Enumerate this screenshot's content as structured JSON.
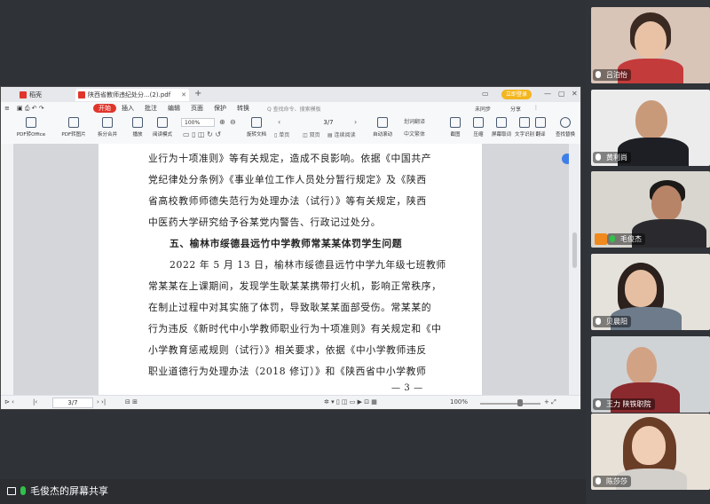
{
  "wps": {
    "tabs": [
      {
        "label": "稻壳"
      },
      {
        "label": "陕西省教师违纪处分...(2).pdf"
      }
    ],
    "login_label": "立即登录",
    "menu": [
      "开始",
      "插入",
      "批注",
      "编辑",
      "页面",
      "保护",
      "转换"
    ],
    "menu_search": "Q 查找命令、搜索模板",
    "menu_right": [
      "未同步",
      "分享"
    ],
    "toolbar": [
      {
        "label": "PDF转Office"
      },
      {
        "label": "PDF转图片"
      },
      {
        "label": "拆分合并"
      },
      {
        "label": "播放"
      },
      {
        "label": "阅读模式"
      },
      {
        "label": "旋转文档"
      },
      {
        "label": "单页"
      },
      {
        "label": "双页"
      },
      {
        "label": "连续阅读"
      },
      {
        "label": "自动滚动"
      },
      {
        "label": "截图"
      },
      {
        "label": "压缩"
      },
      {
        "label": "屏幕取词"
      },
      {
        "label": "文字识别"
      },
      {
        "label": "翻译"
      },
      {
        "label": "查找替换"
      }
    ],
    "zoom": "100%",
    "page_indicator": "3/7",
    "toolbar_extra": [
      "划词翻译",
      "中文繁体"
    ],
    "document": {
      "lines": [
        "业行为十项准则》等有关规定，造成不良影响。依据《中国共产",
        "党纪律处分条例》《事业单位工作人员处分暂行规定》及《陕西",
        "省高校教师师德失范行为处理办法（试行）》等有关规定，陕西",
        "中医药大学研究给予谷某党内警告、行政记过处分。",
        "五、榆林市绥德县远竹中学教师常某某体罚学生问题",
        "2022 年 5 月 13 日，榆林市绥德县远竹中学九年级七班教师",
        "常某某在上课期间，发现学生耿某某携带打火机，影响正常秩序，",
        "在制止过程中对其实施了体罚，导致耿某某面部受伤。常某某的",
        "行为违反《新时代中小学教师职业行为十项准则》有关规定和《中",
        "小学教育惩戒规则（试行）》相关要求，依据《中小学教师违反",
        "职业道德行为处理办法（2018 修订）》和《陕西省中小学教师"
      ],
      "page_number": "— 3 —"
    },
    "status": {
      "page": "3/7",
      "zoom": "100%"
    }
  },
  "participants": [
    {
      "name": "吕泊怡"
    },
    {
      "name": "黄利尚"
    },
    {
      "name": "毛俊杰"
    },
    {
      "name": "贝晨阳"
    },
    {
      "name": "王力 陕铁职院"
    },
    {
      "name": "陈莎莎"
    }
  ],
  "share_label": "毛俊杰的屏幕共享"
}
